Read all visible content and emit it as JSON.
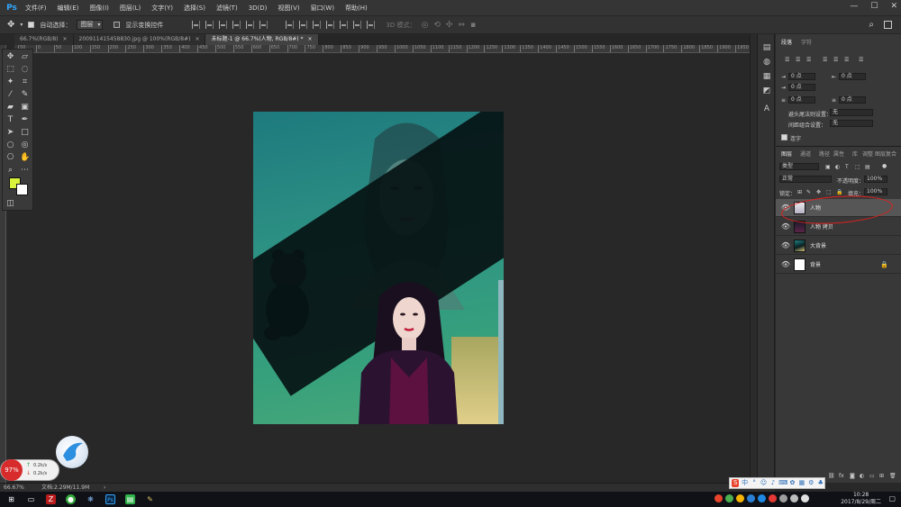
{
  "menubar": {
    "logo": "Ps",
    "items": [
      "文件(F)",
      "编辑(E)",
      "图像(I)",
      "图层(L)",
      "文字(Y)",
      "选择(S)",
      "滤镜(T)",
      "3D(D)",
      "视图(V)",
      "窗口(W)",
      "帮助(H)"
    ],
    "window_controls": [
      "—",
      "☐",
      "✕"
    ]
  },
  "options_bar": {
    "auto_select_label": "自动选择：",
    "auto_select_value": "图层",
    "show_transform_label": "显示变换控件",
    "mode_3d_label": "3D 模式："
  },
  "tabs": [
    {
      "label": "66.7%(RGB/8)",
      "close": "×",
      "active": false
    },
    {
      "label": "20091141545883​0.jpg @ 100%(RGB/8#)",
      "close": "×",
      "active": false
    },
    {
      "label": "未标题-1 @ 66.7%(人物, RGB/8#) *",
      "close": "×",
      "active": true
    }
  ],
  "ruler": {
    "ticks": [
      "50",
      "0",
      "50",
      "100",
      "150",
      "200",
      "250",
      "300",
      "350",
      "400",
      "450",
      "500",
      "550",
      "600",
      "650",
      "700",
      "750",
      "800",
      "850",
      "900",
      "950",
      "1000",
      "1050",
      "1100",
      "1150",
      "1200",
      "1250",
      "1300",
      "1350",
      "1400",
      "1450",
      "1500",
      "1550",
      "1600",
      "1650",
      "1700",
      "1750",
      "1800",
      "1850",
      "1900",
      "1950"
    ]
  },
  "colors": {
    "foreground": "#d9f23c",
    "background": "#ffffff",
    "annotation": "#e0201e"
  },
  "paragraph_panel": {
    "tabs": [
      "段落",
      "字符"
    ],
    "fields": [
      "0 点",
      "0 点",
      "0 点",
      "0 点",
      "0 点"
    ],
    "kinsoku_label": "避头尾法则设置：",
    "kinsoku_value": "无",
    "mojikumi_label": "间距组合设置：",
    "mojikumi_value": "无",
    "hyphenate_label": "连字"
  },
  "layers_panel": {
    "tabs": [
      "图层",
      "通道",
      "路径",
      "属性",
      "库",
      "调整",
      "图层复合"
    ],
    "filter_kind": "类型",
    "blend_mode": "正常",
    "opacity_label": "不透明度：",
    "opacity_value": "100%",
    "lock_label": "锁定：",
    "fill_label": "填充：",
    "fill_value": "100%",
    "layers": [
      {
        "name": "人物",
        "selected": true,
        "locked": false
      },
      {
        "name": "人物 拷贝",
        "selected": false,
        "locked": false
      },
      {
        "name": "大背景",
        "selected": false,
        "locked": false
      },
      {
        "name": "背景",
        "selected": false,
        "locked": true
      }
    ]
  },
  "status": {
    "zoom": "66.67%",
    "doc_size": "文档:2.29M/11.9M"
  },
  "widgets": {
    "cpu": "97%",
    "up_speed": "0.2k/s",
    "down_speed": "0.2k/s"
  },
  "ime": {
    "logo": "S",
    "lang": "中"
  },
  "clock": {
    "time": "10:28",
    "date": "2017/8/29/周二"
  }
}
